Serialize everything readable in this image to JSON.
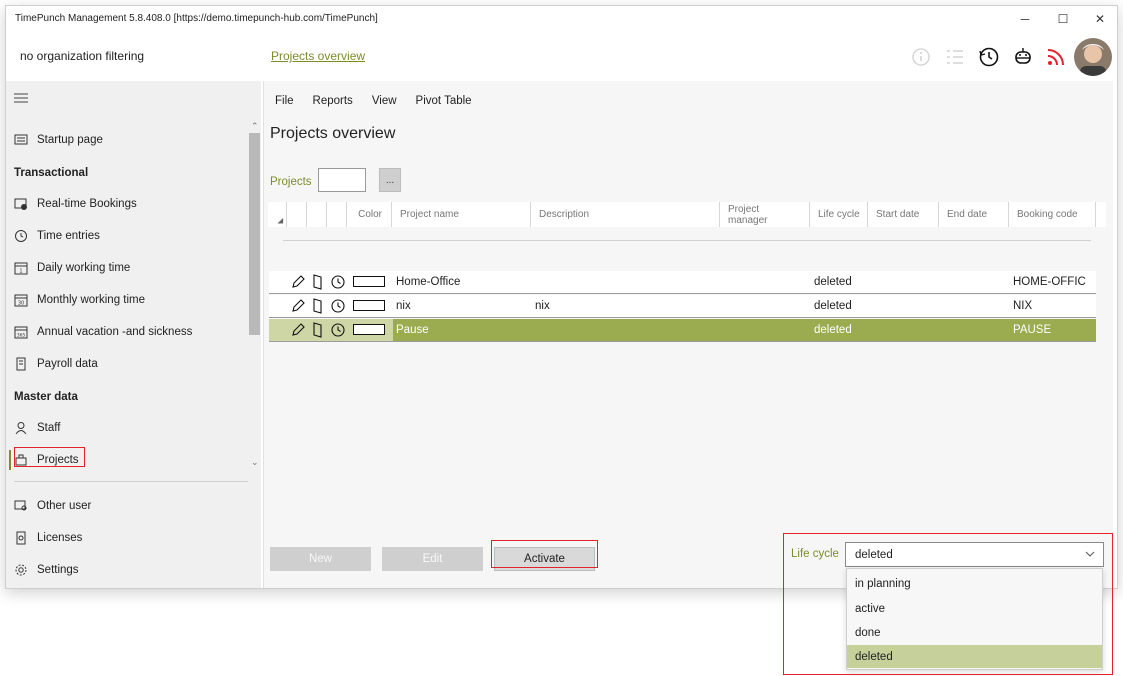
{
  "window": {
    "title": "TimePunch Management 5.8.408.0 [https://demo.timepunch-hub.com/TimePunch]",
    "controls": [
      "─",
      "☐",
      "✕"
    ]
  },
  "topbar": {
    "org_filter": "no organization filtering",
    "breadcrumb": "Projects overview"
  },
  "sidebar": {
    "items": [
      {
        "label": "Startup page",
        "icon": "screen-icon"
      },
      {
        "section": "Transactional"
      },
      {
        "label": "Real-time Bookings",
        "icon": "clock-screen-icon"
      },
      {
        "label": "Time entries",
        "icon": "clock-icon"
      },
      {
        "label": "Daily working time",
        "icon": "calendar-1-icon"
      },
      {
        "label": "Monthly working time",
        "icon": "calendar-30-icon"
      },
      {
        "label": "Annual vacation -and sickness",
        "icon": "calendar-365-icon"
      },
      {
        "label": "Payroll data",
        "icon": "document-icon"
      },
      {
        "section": "Master data"
      },
      {
        "label": "Staff",
        "icon": "person-icon"
      },
      {
        "label": "Projects",
        "icon": "projects-icon"
      },
      {
        "label": "Other user",
        "icon": "other-user-icon"
      },
      {
        "label": "Licenses",
        "icon": "license-icon"
      },
      {
        "label": "Settings",
        "icon": "gear-icon"
      }
    ]
  },
  "menu": [
    "File",
    "Reports",
    "View",
    "Pivot Table"
  ],
  "page": {
    "title": "Projects overview",
    "projects_label": "Projects",
    "projects_input_value": "",
    "dots_label": "..."
  },
  "grid": {
    "columns": [
      "Color",
      "Project name",
      "Description",
      "Project manager",
      "Life cycle",
      "Start date",
      "End date",
      "Booking code"
    ],
    "rows": [
      {
        "project_name": "Home-Office",
        "description": "",
        "project_manager": "",
        "life_cycle": "deleted",
        "start_date": "",
        "end_date": "",
        "booking_code": "HOME-OFFIC",
        "selected": false
      },
      {
        "project_name": "nix",
        "description": "nix",
        "project_manager": "",
        "life_cycle": "deleted",
        "start_date": "",
        "end_date": "",
        "booking_code": "NIX",
        "selected": false
      },
      {
        "project_name": "Pause",
        "description": "",
        "project_manager": "",
        "life_cycle": "deleted",
        "start_date": "",
        "end_date": "",
        "booking_code": "PAUSE",
        "selected": true
      }
    ]
  },
  "buttons": {
    "new": "New",
    "edit": "Edit",
    "activate": "Activate"
  },
  "lifecycle": {
    "label": "Life cycle",
    "selected": "deleted",
    "options": [
      "in planning",
      "active",
      "done",
      "deleted"
    ]
  },
  "colors": {
    "accent": "#7d8c2c",
    "selected_row": "#9aab50",
    "highlight_outline": "#e3232c",
    "dropdown_selected": "#c6d09a"
  }
}
